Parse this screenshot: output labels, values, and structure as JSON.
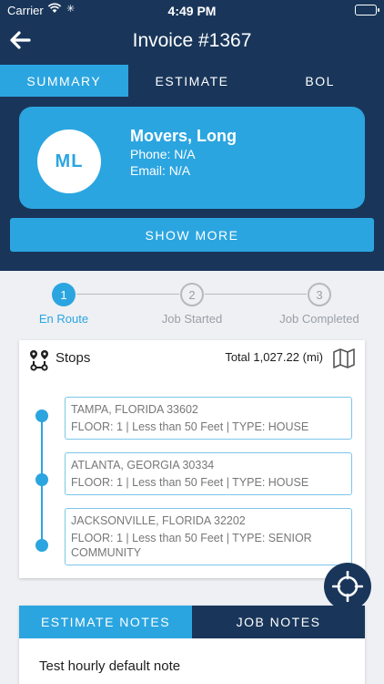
{
  "status_bar": {
    "carrier": "Carrier",
    "time": "4:49 PM",
    "battery_percent": 100
  },
  "header": {
    "title": "Invoice #1367",
    "back_icon": "arrow-left-icon"
  },
  "tabs": [
    {
      "label": "SUMMARY",
      "active": true
    },
    {
      "label": "ESTIMATE",
      "active": false
    },
    {
      "label": "BOL",
      "active": false
    }
  ],
  "customer": {
    "initials": "ML",
    "name": "Movers, Long",
    "phone": "Phone: N/A",
    "email": "Email: N/A"
  },
  "show_more_label": "SHOW MORE",
  "steps": [
    {
      "number": "1",
      "label": "En Route",
      "state": "current"
    },
    {
      "number": "2",
      "label": "Job Started",
      "state": "pending"
    },
    {
      "number": "3",
      "label": "Job Completed",
      "state": "pending"
    }
  ],
  "stops": {
    "title": "Stops",
    "total": "Total 1,027.22 (mi)",
    "items": [
      {
        "city": "TAMPA, FLORIDA 33602",
        "details": "FLOOR: 1  | Less than 50 Feet | TYPE: HOUSE"
      },
      {
        "city": "ATLANTA, GEORGIA 30334",
        "details": "FLOOR: 1  | Less than 50 Feet | TYPE: HOUSE"
      },
      {
        "city": "JACKSONVILLE, FLORIDA 32202",
        "details": "FLOOR: 1  | Less than 50 Feet | TYPE: SENIOR COMMUNITY"
      }
    ]
  },
  "notes": {
    "tabs": [
      {
        "label": "ESTIMATE NOTES",
        "active": true
      },
      {
        "label": "JOB NOTES",
        "active": false
      }
    ],
    "text": "Test hourly default note"
  },
  "colors": {
    "navy": "#19365a",
    "accent": "#2ba5e0",
    "background": "#eef0f4"
  }
}
